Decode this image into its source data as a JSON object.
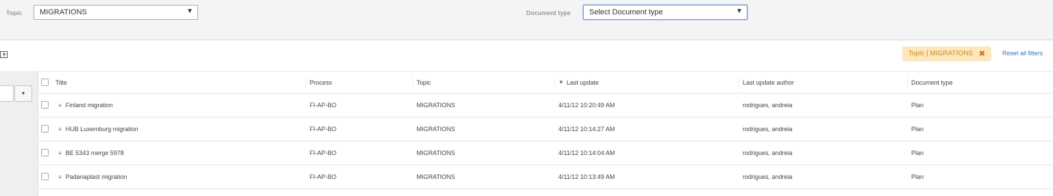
{
  "filters": {
    "topic_label": "Topic",
    "topic_value": "MIGRATIONS",
    "doctype_label": "Document type",
    "doctype_value": "Select Document type",
    "caret": "▼"
  },
  "toolbar": {
    "export_icon": "export-icon",
    "active_filter": "Topic | MIGRATIONS",
    "remove_symbol": "✖",
    "reset_label": "Reset all filters"
  },
  "left": {
    "dropdown_caret": "▾"
  },
  "table": {
    "headers": {
      "title": "Title",
      "process": "Process",
      "topic": "Topic",
      "last_update": "Last update",
      "author": "Last update author",
      "doctype": "Document type",
      "sort_indicator": "▼"
    },
    "doc_icon": "≡",
    "rows": [
      {
        "title": "Finland migration",
        "process": "FI-AP-BO",
        "topic": "MIGRATIONS",
        "last_update": "4/11/12 10:20:49 AM",
        "author": "rodrigues, andreia",
        "doctype": "Plan"
      },
      {
        "title": "HUB Luxemburg migration",
        "process": "FI-AP-BO",
        "topic": "MIGRATIONS",
        "last_update": "4/11/12 10:14:27 AM",
        "author": "rodrigues, andreia",
        "doctype": "Plan"
      },
      {
        "title": "BE 5343 merge 5978",
        "process": "FI-AP-BO",
        "topic": "MIGRATIONS",
        "last_update": "4/11/12 10:14:04 AM",
        "author": "rodrigues, andreia",
        "doctype": "Plan"
      },
      {
        "title": "Padanaplast migration",
        "process": "FI-AP-BO",
        "topic": "MIGRATIONS",
        "last_update": "4/11/12 10:13:49 AM",
        "author": "rodrigues, andreia",
        "doctype": "Plan"
      }
    ]
  }
}
